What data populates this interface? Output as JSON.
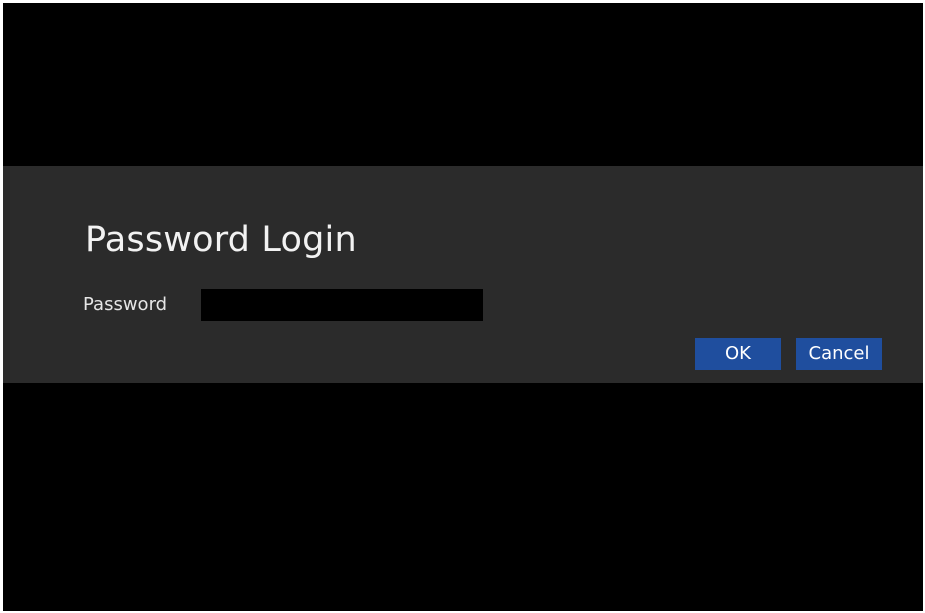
{
  "dialog": {
    "title": "Password Login",
    "password_label": "Password",
    "password_value": "",
    "ok_label": "OK",
    "cancel_label": "Cancel"
  },
  "colors": {
    "background": "#000000",
    "dialog_band": "#2b2b2b",
    "button": "#1f4e9e",
    "text": "#f2f2f2"
  }
}
